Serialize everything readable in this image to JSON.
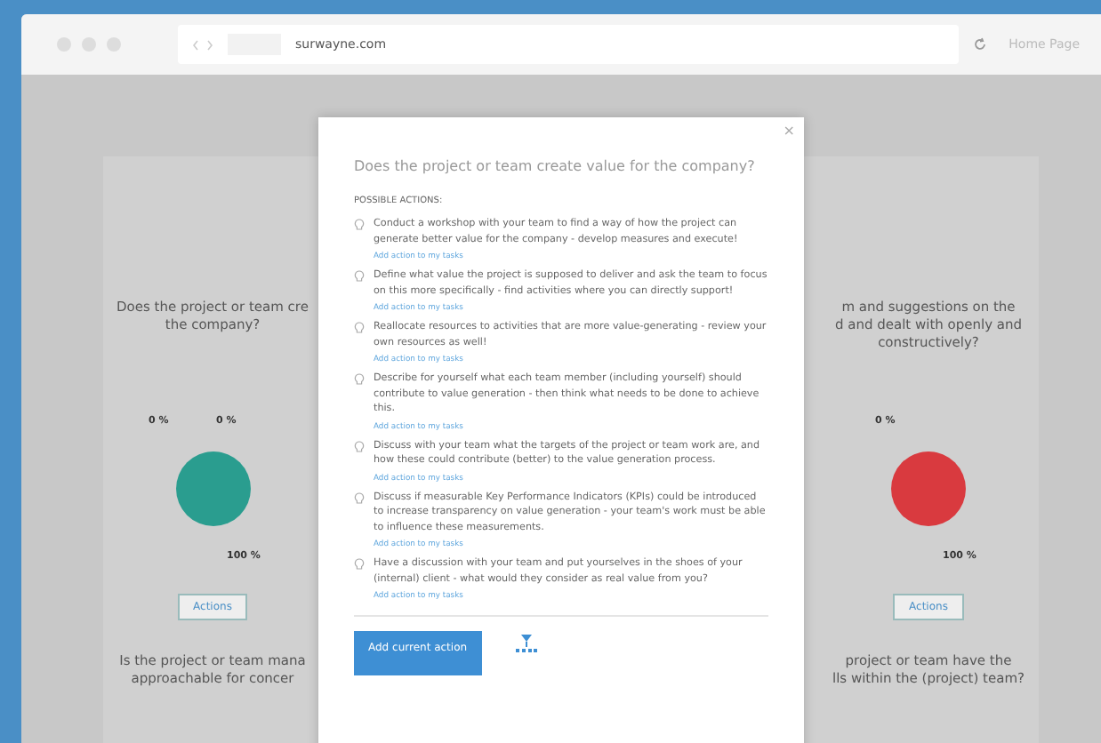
{
  "browser": {
    "address": "surwayne.com",
    "home_link": "Home Page"
  },
  "cards": [
    {
      "question_lines": [
        "Does the project or team cre",
        "the company?"
      ],
      "color": "#2a9d8f",
      "pie_labels": [
        "0 %",
        "0 %",
        "100 %"
      ],
      "button": "Actions",
      "next_question_lines": [
        "Is the project or team mana",
        "approachable for concer"
      ]
    },
    {
      "question_lines": [
        "m and suggestions on the",
        "d and dealt with openly and",
        "constructively?"
      ],
      "color": "#d93a3f",
      "pie_labels": [
        "0 %",
        "100 %"
      ],
      "button": "Actions",
      "next_question_lines": [
        "project or team have the",
        "lls within the (project) team?"
      ]
    }
  ],
  "modal": {
    "close": "×",
    "title": "Does the project or team create value for the company?",
    "section_label": "POSSIBLE ACTIONS:",
    "actions": [
      {
        "text": "Conduct a workshop with your team to find a way of how the project can generate better value for the company - develop measures and execute!",
        "link": "Add action to my tasks"
      },
      {
        "text": "Define what value the project is supposed to deliver and ask the team to focus on this more specifically - find activities where you can directly support!",
        "link": "Add action to my tasks"
      },
      {
        "text": "Reallocate resources to activities that are more value-generating - review your own resources as well!",
        "link": "Add action to my tasks"
      },
      {
        "text": "Describe for yourself what each team member (including yourself) should contribute to value generation - then think what needs to be done to achieve this.",
        "link": "Add action to my tasks"
      },
      {
        "text": "Discuss with your team what the targets of the project or team work are, and how these could contribute (better) to the value generation process.",
        "link": "Add action to my tasks"
      },
      {
        "text": "Discuss if measurable Key Performance Indicators (KPIs) could be introduced to increase transparency on value generation - your team's work must be able to influence these measurements.",
        "link": "Add action to my tasks"
      },
      {
        "text": "Have a discussion with your team and put yourselves in the shoes of your (internal) client - what would they consider as real value from you?",
        "link": "Add action to my tasks"
      }
    ],
    "primary_button": "Add current action"
  }
}
